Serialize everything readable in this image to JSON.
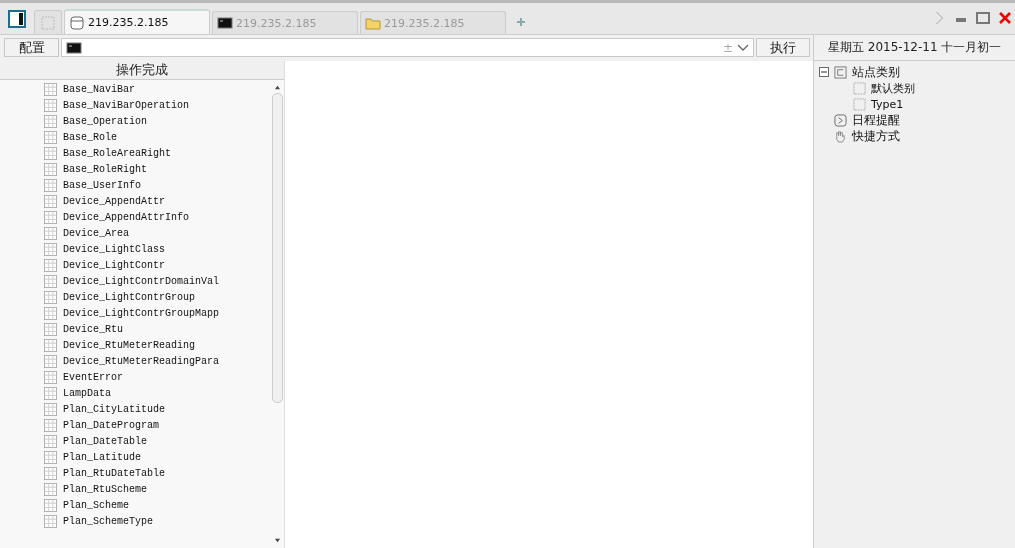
{
  "tabs": [
    {
      "label": "219.235.2.185",
      "kind": "database",
      "selected": true
    },
    {
      "label": "219.235.2.185",
      "kind": "terminal",
      "selected": false
    },
    {
      "label": "219.235.2.185",
      "kind": "folder",
      "selected": false
    }
  ],
  "toolbar": {
    "config_button": "配置",
    "command_symbol": "±",
    "run_button": "执行"
  },
  "left_pane": {
    "header": "操作完成",
    "tables": [
      "Base_NaviBar",
      "Base_NaviBarOperation",
      "Base_Operation",
      "Base_Role",
      "Base_RoleAreaRight",
      "Base_RoleRight",
      "Base_UserInfo",
      "Device_AppendAttr",
      "Device_AppendAttrInfo",
      "Device_Area",
      "Device_LightClass",
      "Device_LightContr",
      "Device_LightContrDomainVal",
      "Device_LightContrGroup",
      "Device_LightContrGroupMapp",
      "Device_Rtu",
      "Device_RtuMeterReading",
      "Device_RtuMeterReadingPara",
      "EventError",
      "LampData",
      "Plan_CityLatitude",
      "Plan_DateProgram",
      "Plan_DateTable",
      "Plan_Latitude",
      "Plan_RtuDateTable",
      "Plan_RtuScheme",
      "Plan_Scheme",
      "Plan_SchemeType"
    ]
  },
  "right_panel": {
    "date": "星期五 2015-12-11 十一月初一",
    "tree": [
      {
        "label": "站点类别",
        "kind": "category",
        "expanded": true,
        "children": [
          {
            "label": "默认类别",
            "kind": "item"
          },
          {
            "label": "Type1",
            "kind": "item"
          }
        ]
      },
      {
        "label": "日程提醒",
        "kind": "schedule"
      },
      {
        "label": "快捷方式",
        "kind": "shortcut"
      }
    ]
  }
}
